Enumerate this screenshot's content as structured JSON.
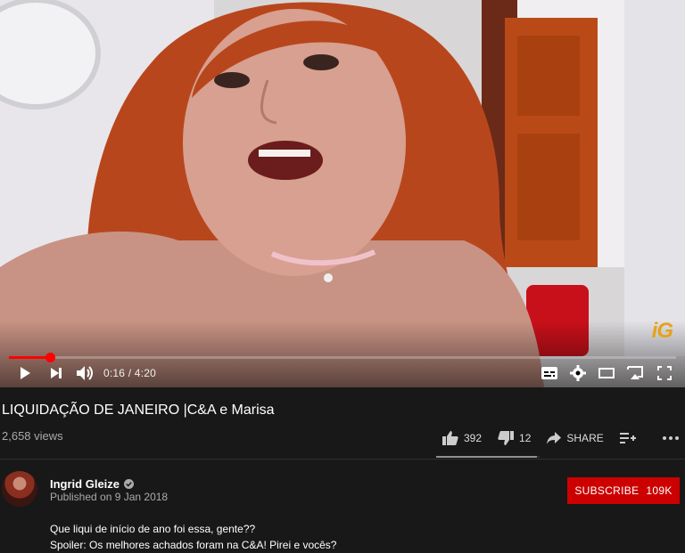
{
  "player": {
    "current_time": "0:16",
    "time_separator": "/",
    "duration": "4:20",
    "progress_fraction": 0.0615,
    "watermark": "iG",
    "icons": [
      "play-icon",
      "next-icon",
      "volume-icon",
      "subtitles-icon",
      "settings-icon",
      "theater-icon",
      "cast-icon",
      "fullscreen-icon"
    ]
  },
  "video": {
    "title": "LIQUIDAÇÃO DE JANEIRO |C&A e Marisa",
    "views": "2,658 views"
  },
  "actions": {
    "likes": "392",
    "dislikes": "12",
    "share_label": "SHARE",
    "like_ratio": 0.97
  },
  "channel": {
    "name": "Ingrid Gleize",
    "published": "Published on 9 Jan 2018",
    "subscribe_label": "SUBSCRIBE",
    "subscriber_count": "109K"
  },
  "description": {
    "line1": "Que liqui de início de ano foi essa, gente??",
    "line2": "Spoiler: Os melhores achados foram na C&A! Pirei e vocês?"
  },
  "colors": {
    "background": "#181818",
    "accent_red": "#cc0000",
    "progress_red": "#ff0000",
    "watermark": "#e6a21a"
  }
}
